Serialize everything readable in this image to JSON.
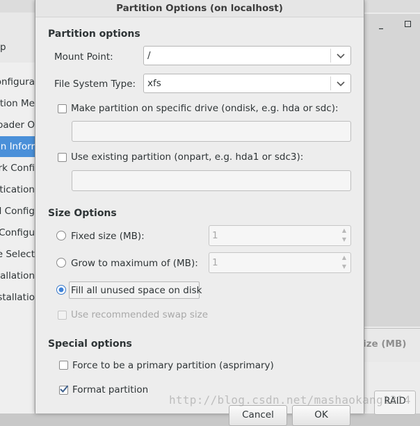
{
  "background_window": {
    "left_header_fragment": "p",
    "sidebar_items": [
      {
        "label": "onfigura",
        "active": false
      },
      {
        "label": "ation Me",
        "active": false
      },
      {
        "label": "oader O",
        "active": false
      },
      {
        "label": "on Inforr",
        "active": true
      },
      {
        "label": "rk Confi",
        "active": false
      },
      {
        "label": "tication",
        "active": false
      },
      {
        "label": "ll Config",
        "active": false
      },
      {
        "label": "r Configu",
        "active": false
      },
      {
        "label": "e Select",
        "active": false
      },
      {
        "label": "stallation",
        "active": false
      },
      {
        "label": "stallatio",
        "active": false
      }
    ],
    "minimize_glyph": "_",
    "size_column_header": "ize (MB)",
    "raid_button": "RAID"
  },
  "dialog": {
    "title": "Partition Options (on localhost)",
    "partition_options": {
      "heading": "Partition options",
      "mount_point_label": "Mount Point:",
      "mount_point_value": "/",
      "fs_type_label": "File System Type:",
      "fs_type_value": "xfs",
      "ondisk_label": "Make partition on specific drive (ondisk, e.g. hda or sdc):",
      "ondisk_checked": false,
      "ondisk_value": "",
      "onpart_label": "Use existing partition (onpart, e.g. hda1 or sdc3):",
      "onpart_checked": false,
      "onpart_value": ""
    },
    "size_options": {
      "heading": "Size Options",
      "fixed_label": "Fixed size (MB):",
      "fixed_value": "1",
      "grow_label": "Grow to maximum of (MB):",
      "grow_value": "1",
      "fill_label": "Fill all unused space on disk",
      "selected": "fill",
      "swap_label": "Use recommended swap size",
      "swap_checked": false
    },
    "special_options": {
      "heading": "Special options",
      "primary_label": "Force to be a primary partition (asprimary)",
      "primary_checked": false,
      "format_label": "Format partition",
      "format_checked": true
    },
    "buttons": {
      "cancel": "Cancel",
      "ok": "OK"
    }
  },
  "watermark": "http://blog.csdn.net/mashaokang1314",
  "colors": {
    "accent": "#4a90d9",
    "radio_selected": "#3e82d8"
  }
}
